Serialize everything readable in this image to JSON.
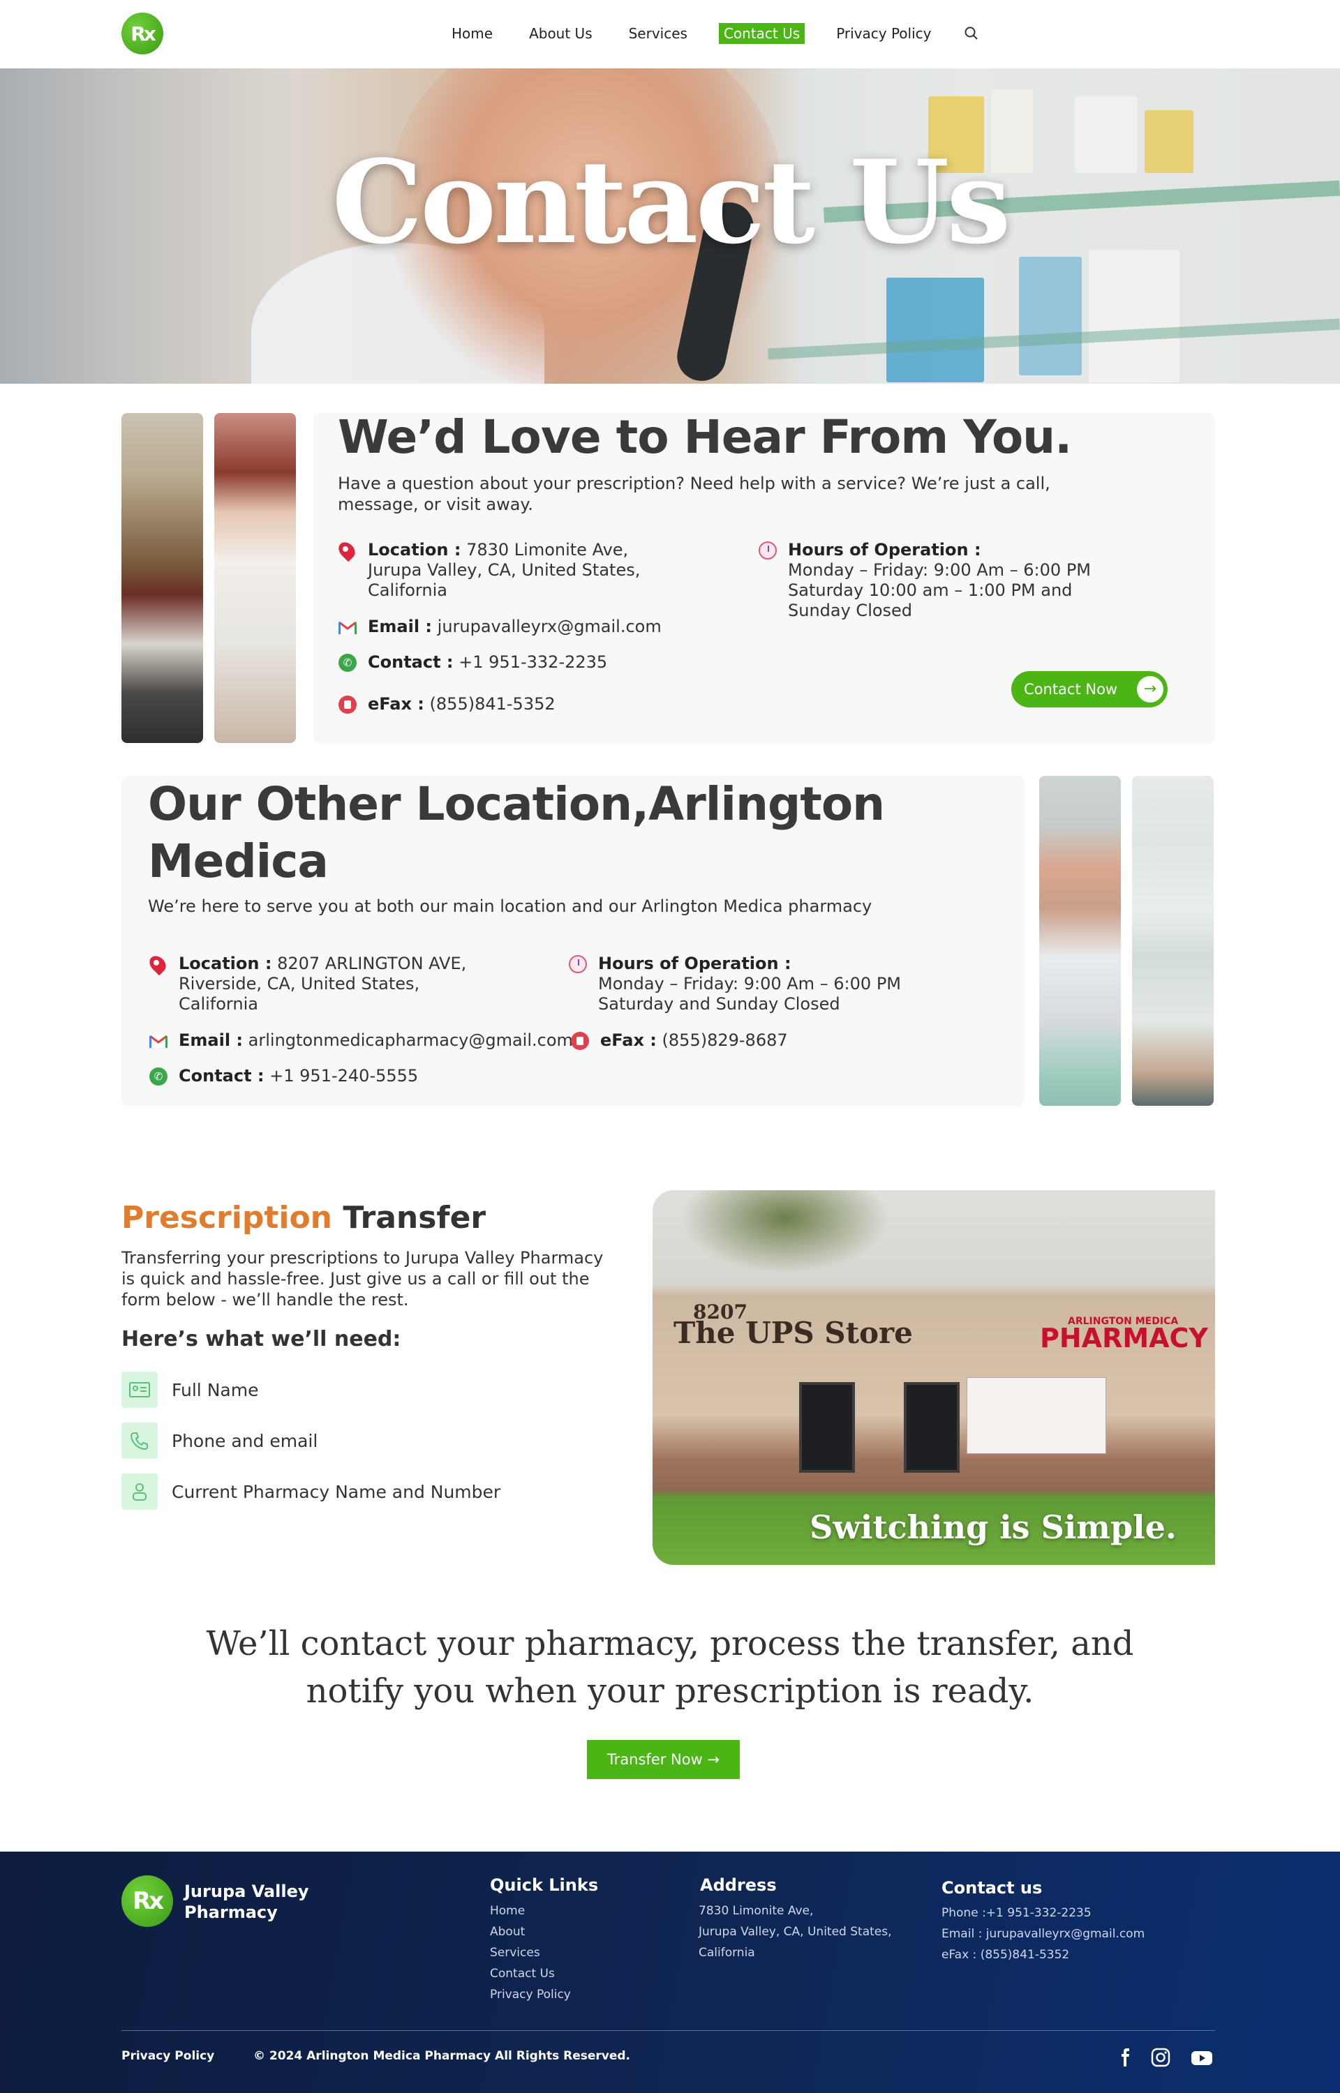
{
  "header": {
    "logo_alt": "Rx",
    "nav": [
      "Home",
      "About Us",
      "Services",
      "Contact Us",
      "Privacy Policy"
    ],
    "active_nav": "Contact Us"
  },
  "hero": {
    "title": "Contact Us"
  },
  "main_location": {
    "heading": "We’d Love to Hear From You.",
    "lead": "Have a question about your prescription? Need help with a service? We’re just a call, message, or visit away.",
    "location_label": "Location :",
    "location_line1": "7830 Limonite Ave,",
    "location_line2": "Jurupa Valley, CA, United States,",
    "location_line3": "California",
    "email_label": "Email :",
    "email": "jurupavalleyrx@gmail.com",
    "contact_label": "Contact :",
    "contact": "+1 951-332-2235",
    "efax_label": "eFax :",
    "efax": "(855)841-5352",
    "hours_label": "Hours of Operation :",
    "hours_line1": "Monday – Friday: 9:00 Am – 6:00 PM",
    "hours_line2": "Saturday 10:00 am – 1:00 PM and",
    "hours_line3": "Sunday Closed",
    "button": "Contact Now"
  },
  "other_location": {
    "heading_line1": "Our Other Location,Arlington",
    "heading_line2": "Medica",
    "lead": "We’re here to serve you at both our main location and our Arlington Medica pharmacy",
    "location_label": "Location :",
    "location_line1": "8207 ARLINGTON AVE,",
    "location_line2": "Riverside, CA, United States,",
    "location_line3": "California",
    "email_label": "Email :",
    "email": "arlingtonmedicapharmacy@gmail.com",
    "contact_label": "Contact :",
    "contact": "+1 951-240-5555",
    "hours_label": "Hours of Operation :",
    "hours_line1": "Monday – Friday: 9:00 Am – 6:00 PM",
    "hours_line2": "Saturday and Sunday Closed",
    "efax_label": "eFax :",
    "efax": "(855)829-8687"
  },
  "prescription": {
    "title_orange": "Prescription",
    "title_dark": "Transfer",
    "body": "Transferring your prescriptions to Jurupa Valley Pharmacy  is quick and hassle-free. Just give us a call or fill out the form below - we’ll handle the rest.",
    "need_title": "Here’s what we’ll need:",
    "needs": [
      "Full Name",
      "Phone and email",
      "Current Pharmacy Name and Number"
    ],
    "store_number": "8207",
    "store_sign": "The UPS Store",
    "pharmacy_sign_small": "ARLINGTON MEDICA",
    "pharmacy_sign": "PHARMACY",
    "image_caption": "Switching is Simple."
  },
  "cta": {
    "line1": "We’ll contact your pharmacy, process the transfer, and",
    "line2": "notify you when your prescription is ready.",
    "button": "Transfer Now →"
  },
  "footer": {
    "brand_line1": "Jurupa Valley",
    "brand_line2": "Pharmacy",
    "quick_links_title": "Quick Links",
    "quick_links": [
      "Home",
      "About",
      "Services",
      "Contact Us",
      "Privacy Policy"
    ],
    "address_title": "Address",
    "address_lines": [
      "7830 Limonite Ave,",
      "Jurupa Valley, CA, United States,",
      "California"
    ],
    "contact_title": "Contact us",
    "contact_lines": [
      "Phone :+1 951-332-2235",
      "Email : jurupavalleyrx@gmail.com",
      "eFax : (855)841-5352"
    ],
    "privacy": "Privacy Policy",
    "copyright": "© 2024 Arlington Medica Pharmacy All Rights Reserved.",
    "social": [
      "facebook-icon",
      "instagram-icon",
      "youtube-icon"
    ]
  },
  "colors": {
    "brand_green": "#4bb516",
    "accent_orange": "#e07c2b",
    "footer_navy": "#0f2551"
  }
}
